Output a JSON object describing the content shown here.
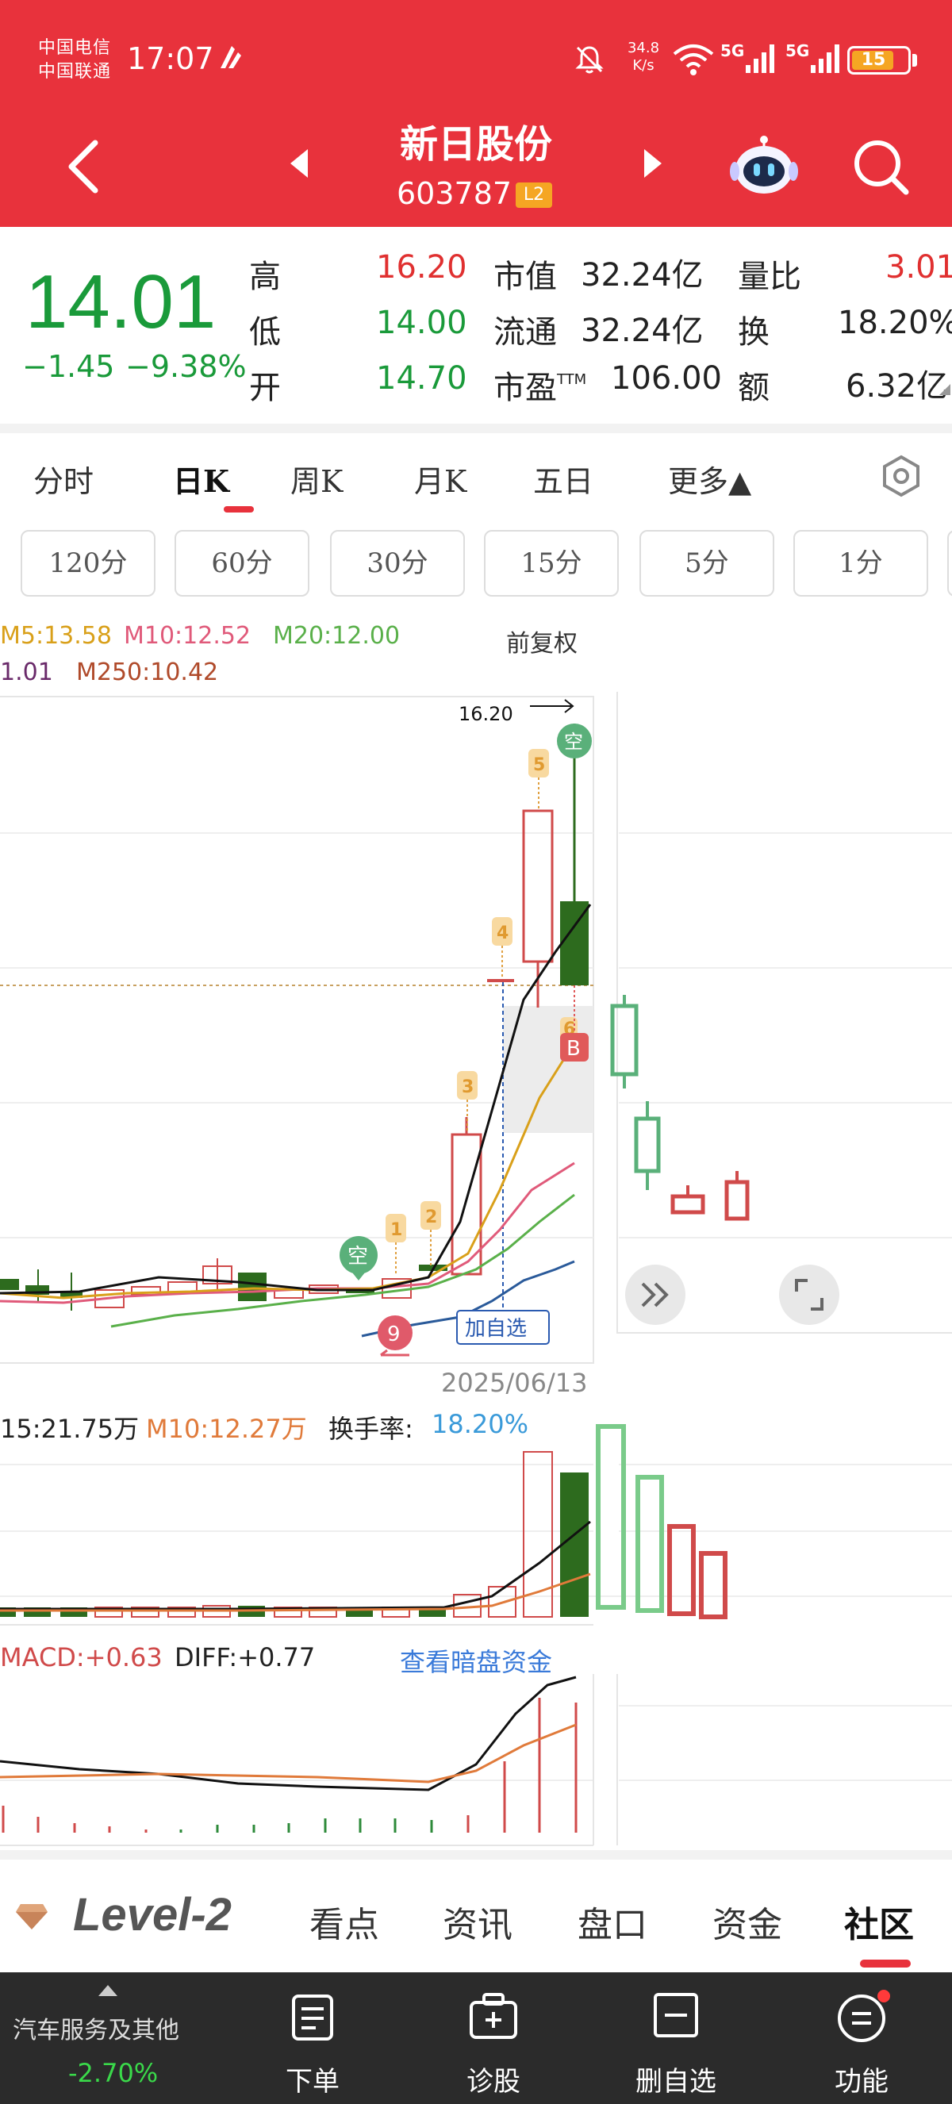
{
  "status_bar": {
    "carrier_1": "中国电信",
    "carrier_2": "中国联通",
    "time": "17:07",
    "net_speed_value": "34.8",
    "net_speed_unit": "K/s",
    "signal_1": "5G",
    "signal_2": "5G",
    "battery": "15"
  },
  "header": {
    "stock_name": "新日股份",
    "stock_code": "603787",
    "badge": "L2",
    "icons": [
      "back-icon",
      "prev-arrow-icon",
      "next-arrow-icon",
      "robot-icon",
      "search-icon"
    ]
  },
  "quote": {
    "price": "14.01",
    "change": "−1.45",
    "change_pct": "−9.38%",
    "rows": [
      {
        "l1": "高",
        "v1": "16.20",
        "l2": "市值",
        "v2": "32.24亿",
        "l3": "量比",
        "v3": "3.01"
      },
      {
        "l1": "低",
        "v1": "14.00",
        "l2": "流通",
        "v2": "32.24亿",
        "l3": "换",
        "v3": "18.20%"
      },
      {
        "l1": "开",
        "v1": "14.70",
        "l2": "市盈",
        "l2sup": "TTM",
        "v2": "106.00",
        "l3": "额",
        "v3": "6.32亿"
      }
    ]
  },
  "period_tabs": [
    {
      "label": "分时",
      "active": false
    },
    {
      "label": "日K",
      "active": true
    },
    {
      "label": "周K",
      "active": false
    },
    {
      "label": "月K",
      "active": false
    },
    {
      "label": "五日",
      "active": false
    },
    {
      "label": "更多▲",
      "active": false
    }
  ],
  "minute_buttons": [
    "120分",
    "60分",
    "30分",
    "15分",
    "5分",
    "1分"
  ],
  "chart": {
    "ma_row1": [
      {
        "text": "M5:13.58",
        "color": "#d9a01a"
      },
      {
        "text": "M10:12.52",
        "color": "#e05a7a"
      },
      {
        "text": "M20:12.00",
        "color": "#5ab04a"
      }
    ],
    "ma_row2": [
      {
        "text": "1.01",
        "color": "#6a2a6a"
      },
      {
        "text": "M250:10.42",
        "color": "#b04a2a"
      }
    ],
    "adjust_label": "前复权",
    "high_marker": "16.20",
    "add_watch_tag": "加自选",
    "signal_kong": "空",
    "signal_b": "B",
    "signal_nine": "9",
    "step_labels": [
      "1",
      "2",
      "3",
      "4",
      "5",
      "6"
    ],
    "date": "2025/06/13"
  },
  "volume": {
    "m5": "15:21.75万",
    "m10": "M10:12.27万",
    "turnover_label": "换手率:",
    "turnover_value": "18.20%"
  },
  "macd": {
    "macd": "MACD:+0.63",
    "diff": "DIFF:+0.77",
    "dark_pool_link": "查看暗盘资金"
  },
  "info_tabs": {
    "logo": "Level-2",
    "tabs": [
      "看点",
      "资讯",
      "盘口",
      "资金",
      "社区"
    ]
  },
  "bottom_bar": {
    "sector_name": "汽车服务及其他",
    "sector_change": "-2.70%",
    "actions": [
      "下单",
      "诊股",
      "删自选",
      "功能"
    ]
  },
  "colors": {
    "brand_red": "#e8323c",
    "up_red": "#e03030",
    "down_green": "#1a9a3a"
  }
}
